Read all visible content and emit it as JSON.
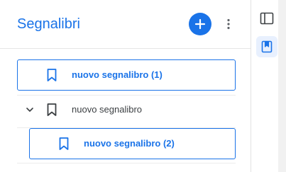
{
  "panel": {
    "title": "Segnalibri",
    "add_button_icon": "plus-icon",
    "more_button_icon": "more-vert-icon"
  },
  "bookmarks": [
    {
      "label": "nuovo segnalibro (1)",
      "icon": "bookmark-icon",
      "selected": true
    },
    {
      "label": "nuovo segnalibro",
      "icon": "bookmark-icon",
      "expanded": true,
      "expander_icon": "chevron-down-icon"
    },
    {
      "label": "nuovo segnalibro (2)",
      "icon": "bookmark-icon",
      "selected": true,
      "child_of": 1
    }
  ],
  "sidebar": {
    "buttons": [
      {
        "icon": "sidebar-toggle-icon",
        "active": false
      },
      {
        "icon": "bookmarks-panel-icon",
        "active": true
      }
    ]
  },
  "colors": {
    "accent": "#1a73e8",
    "text": "#3c4043",
    "divider": "#e6e6e6",
    "active_bg": "#e8f0fe"
  }
}
